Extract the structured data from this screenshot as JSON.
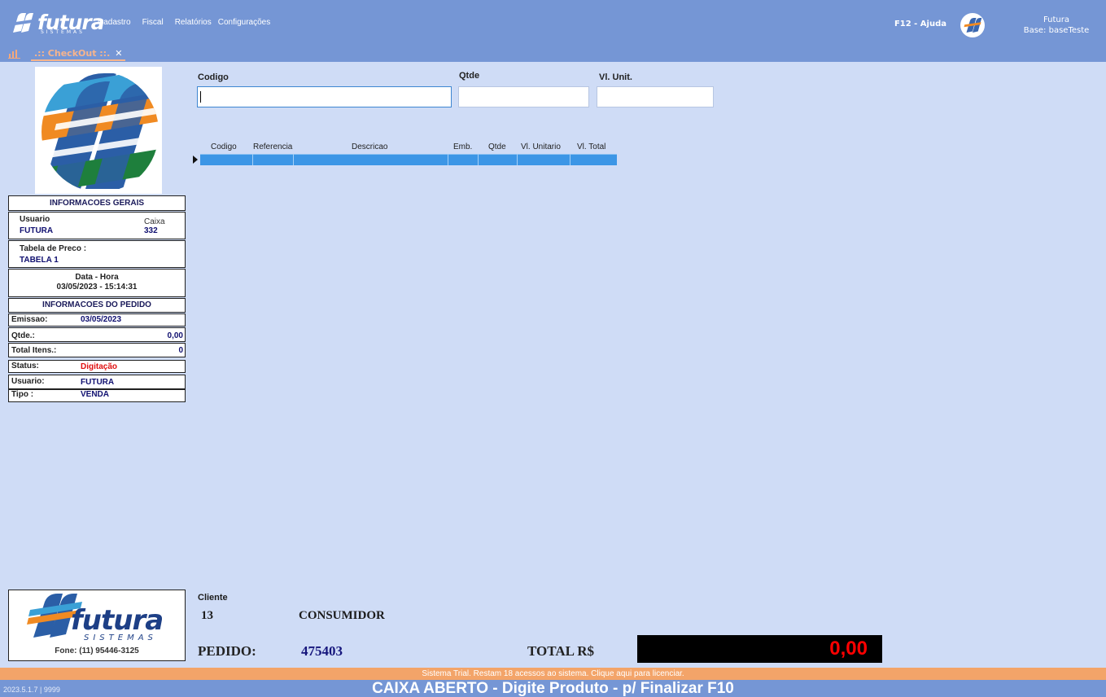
{
  "topbar": {
    "brand": "futura",
    "brand_sub": "SISTEMAS",
    "menu": [
      "Cadastro",
      "Fiscal",
      "Relatórios",
      "Configurações"
    ],
    "help": "F12 - Ajuda",
    "user_name": "Futura",
    "user_base": "Base: baseTeste"
  },
  "tab": {
    "label": ".:: CheckOut ::.",
    "close": "✕"
  },
  "info": {
    "title_gerais": "INFORMACOES GERAIS",
    "usuario_lbl": "Usuario",
    "usuario_val": "FUTURA",
    "caixa_lbl": "Caixa",
    "caixa_val": "332",
    "tabela_lbl": "Tabela de Preco :",
    "tabela_val": "TABELA 1",
    "datahora_lbl": "Data - Hora",
    "datahora_val": "03/05/2023 - 15:14:31",
    "title_pedido": "INFORMACOES DO PEDIDO",
    "emissao_lbl": "Emissao:",
    "emissao_val": "03/05/2023",
    "qtde_lbl": "Qtde.:",
    "qtde_val": "0,00",
    "itens_lbl": "Total Itens.:",
    "itens_val": "0",
    "status_lbl": "Status:",
    "status_val": "Digitação",
    "usuario2_lbl": "Usuario:",
    "usuario2_val": "FUTURA",
    "tipo_lbl": "Tipo :",
    "tipo_val": "VENDA"
  },
  "fields": {
    "codigo": "Codigo",
    "qtde": "Qtde",
    "vlunit": "Vl. Unit."
  },
  "grid": {
    "columns": [
      "Codigo",
      "Referencia",
      "Descricao",
      "Emb.",
      "Qtde",
      "Vl. Unitario",
      "Vl. Total"
    ]
  },
  "footer": {
    "fone": "Fone: (11) 95446-3125",
    "cliente_lbl": "Cliente",
    "cliente_codigo": "13",
    "cliente_nome": "CONSUMIDOR",
    "pedido_lbl": "PEDIDO:",
    "pedido_val": "475403",
    "total_lbl": "TOTAL R$",
    "total_val": "0,00",
    "trial": "Sistema Trial. Restam 18 acessos ao sistema. Clique aqui para licenciar.",
    "version": "2023.5.1.7 | 9999",
    "status": "CAIXA ABERTO - Digite Produto - p/ Finalizar F10"
  },
  "colors": {
    "bar": "#7596d5",
    "bg": "#cfdcf6",
    "accent_orange": "#f3a469",
    "grid_row": "#3c96e6",
    "total_red": "#ff0000"
  }
}
